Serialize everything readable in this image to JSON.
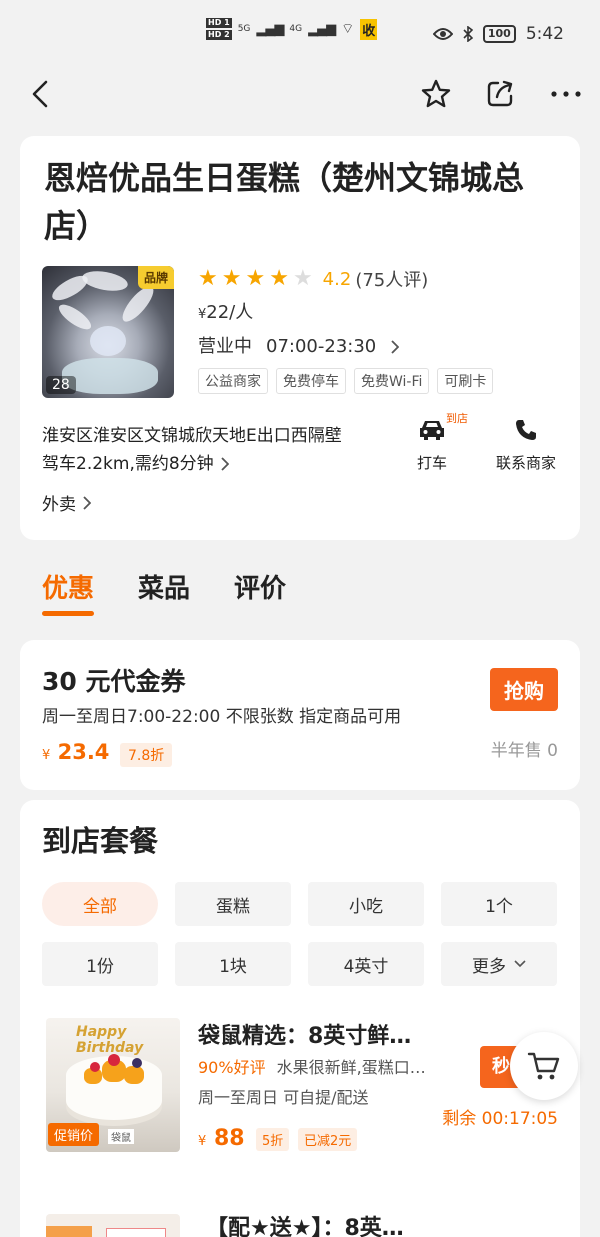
{
  "status_bar": {
    "hd1": "HD 1",
    "hd2": "HD 2",
    "net1": "5G",
    "net2": "4G",
    "shou": "收",
    "battery": "100",
    "time": "5:42"
  },
  "shop": {
    "name": "恩焙优品生日蛋糕（楚州文锦城总店）",
    "brand_tag": "品牌",
    "photo_count": "28",
    "rating_value": "4.2",
    "rating_count": "(75人评)",
    "rating_stars": 4,
    "price_symbol": "¥",
    "price_per_person": "22/人",
    "status": "营业中",
    "hours": "07:00-23:30",
    "tags": [
      "公益商家",
      "免费停车",
      "免费Wi-Fi",
      "可刷卡"
    ],
    "address": "淮安区淮安区文锦城欣天地E出口西隔壁",
    "drive_info": "驾车2.2km,需约8分钟",
    "takeout": "外卖",
    "action_taxi": "打车",
    "action_taxi_badge": "到店",
    "action_contact": "联系商家"
  },
  "tabs": [
    {
      "label": "优惠",
      "active": true
    },
    {
      "label": "菜品",
      "active": false
    },
    {
      "label": "评价",
      "active": false
    }
  ],
  "coupon": {
    "title": "30 元代金券",
    "rule": "周一至周日7:00-22:00  不限张数  指定商品可用",
    "price_symbol": "¥",
    "price": "23.4",
    "discount": "7.8折",
    "buy_label": "抢购",
    "sold": "半年售 0"
  },
  "packages": {
    "title": "到店套餐",
    "filters": [
      "全部",
      "蛋糕",
      "小吃",
      "1个",
      "1份",
      "1块",
      "4英寸",
      "更多"
    ],
    "active_filter": 0,
    "deal1": {
      "image_topper": "Happy Birthday",
      "promo_tag": "促销价",
      "logo_tag": "袋鼠",
      "name": "袋鼠精选：8英寸鲜…",
      "good_rate": "90%好评",
      "desc": "水果很新鲜,蛋糕口…",
      "usage": "周一至周日  可自提/配送",
      "price_symbol": "¥",
      "price": "88",
      "discount": "5折",
      "reduced": "已减2元",
      "countdown": "剩余 00:17:05",
      "button_label": "秒"
    },
    "deal2": {
      "name": "【配★送★】：8英…"
    }
  },
  "colors": {
    "accent": "#f56a00",
    "star": "#f7a500",
    "background": "#f2f2f2"
  }
}
